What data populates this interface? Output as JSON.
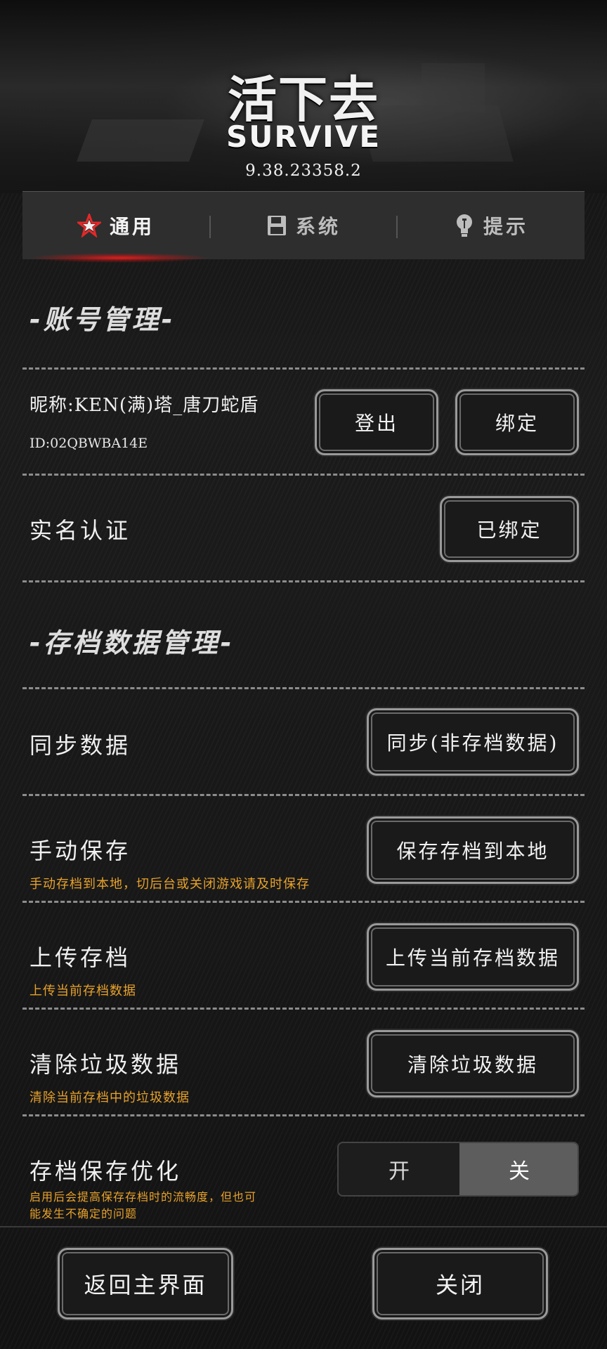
{
  "header": {
    "logo_cn": "活下去",
    "logo_en": "SURVIVE",
    "version": "9.38.23358.2"
  },
  "tabs": [
    {
      "label": "通用",
      "icon": "star-icon",
      "active": true
    },
    {
      "label": "系统",
      "icon": "floppy-disk-icon",
      "active": false
    },
    {
      "label": "提示",
      "icon": "lightbulb-icon",
      "active": false
    }
  ],
  "account": {
    "section_title": "-账号管理-",
    "nickname": "昵称:KEN(满)塔_唐刀蛇盾",
    "id": "ID:02QBWBA14E",
    "logout_label": "登出",
    "bind_label": "绑定",
    "realname_label": "实名认证",
    "realname_status": "已绑定"
  },
  "archive": {
    "section_title": "-存档数据管理-",
    "sync_label": "同步数据",
    "sync_button": "同步(非存档数据)",
    "manual_save_label": "手动保存",
    "manual_save_desc": "手动存档到本地，切后台或关闭游戏请及时保存",
    "manual_save_button": "保存存档到本地",
    "upload_label": "上传存档",
    "upload_desc": "上传当前存档数据",
    "upload_button": "上传当前存档数据",
    "clear_label": "清除垃圾数据",
    "clear_desc": "清除当前存档中的垃圾数据",
    "clear_button": "清除垃圾数据",
    "optimize_label": "存档保存优化",
    "optimize_desc_line1": "启用后会提高保存存档时的流畅度，但也可",
    "optimize_desc_line2": "能发生不确定的问题",
    "toggle_on": "开",
    "toggle_off": "关",
    "toggle_value": "关"
  },
  "footer": {
    "back_label": "返回主界面",
    "close_label": "关闭"
  },
  "colors": {
    "accent_red": "#e61e1e",
    "hint_orange": "#e8a22b"
  }
}
